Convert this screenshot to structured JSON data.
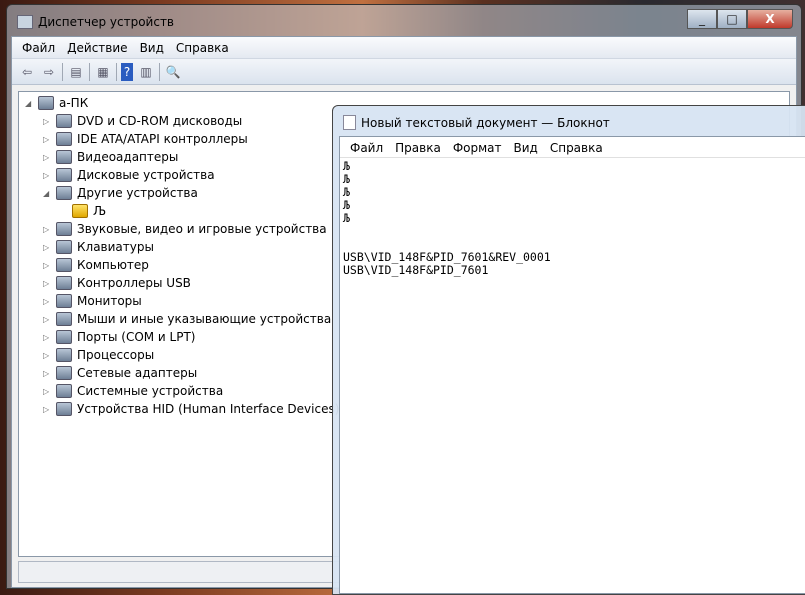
{
  "devmgr": {
    "title": "Диспетчер устройств",
    "menu": [
      "Файл",
      "Действие",
      "Вид",
      "Справка"
    ],
    "caption": {
      "minimize": "_",
      "maximize": "□",
      "close": "X"
    },
    "root": "а-ПК",
    "items": [
      {
        "label": "DVD и CD-ROM дисководы",
        "expanded": false
      },
      {
        "label": "IDE ATA/ATAPI контроллеры",
        "expanded": false
      },
      {
        "label": "Видеоадаптеры",
        "expanded": false
      },
      {
        "label": "Дисковые устройства",
        "expanded": false
      },
      {
        "label": "Другие устройства",
        "expanded": true
      },
      {
        "label": "Љ",
        "child": true,
        "warning": true
      },
      {
        "label": "Звуковые, видео и игровые устройства",
        "expanded": false
      },
      {
        "label": "Клавиатуры",
        "expanded": false
      },
      {
        "label": "Компьютер",
        "expanded": false
      },
      {
        "label": "Контроллеры USB",
        "expanded": false
      },
      {
        "label": "Мониторы",
        "expanded": false
      },
      {
        "label": "Мыши и иные указывающие устройства",
        "expanded": false
      },
      {
        "label": "Порты (COM и LPT)",
        "expanded": false
      },
      {
        "label": "Процессоры",
        "expanded": false
      },
      {
        "label": "Сетевые адаптеры",
        "expanded": false
      },
      {
        "label": "Системные устройства",
        "expanded": false
      },
      {
        "label": "Устройства HID (Human Interface Devices)",
        "expanded": false
      }
    ]
  },
  "notepad": {
    "title": "Новый текстовый документ — Блокнот",
    "menu": [
      "Файл",
      "Правка",
      "Формат",
      "Вид",
      "Справка"
    ],
    "content": "Љ\nЉ\nЉ\nЉ\nЉ\n\n\nUSB\\VID_148F&PID_7601&REV_0001\nUSB\\VID_148F&PID_7601"
  }
}
